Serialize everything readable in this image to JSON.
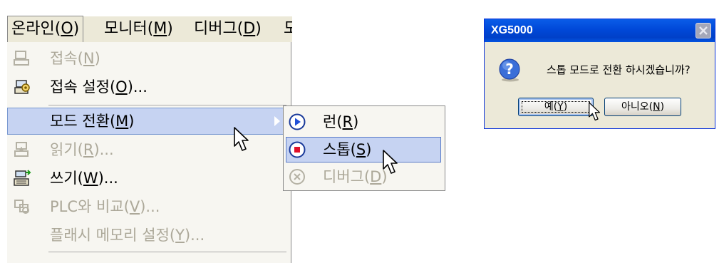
{
  "menubar": {
    "items": [
      {
        "label": "온라인(O)",
        "text": "온라인(",
        "mnemonic": "O",
        "close": ")"
      },
      {
        "label": "모니터(M)",
        "text": "모니터(",
        "mnemonic": "M",
        "close": ")"
      },
      {
        "label": "디버그(D)",
        "text": "디버그(",
        "mnemonic": "D",
        "close": ")"
      },
      {
        "label": "도",
        "text": "도",
        "mnemonic": "",
        "close": ""
      }
    ]
  },
  "dropdown": {
    "items": [
      {
        "text": "접속(",
        "mnemonic": "N",
        "close": ")",
        "icon": "connect-icon",
        "disabled": true
      },
      {
        "text": "접속 설정(",
        "mnemonic": "O",
        "close": ")...",
        "icon": "connection-settings-icon",
        "disabled": false
      },
      {
        "text": "모드 전환(",
        "mnemonic": "M",
        "close": ")",
        "icon": "",
        "disabled": false,
        "highlighted": true,
        "submenu": true
      },
      {
        "text": "읽기(",
        "mnemonic": "R",
        "close": ")...",
        "icon": "read-icon",
        "disabled": true
      },
      {
        "text": "쓰기(",
        "mnemonic": "W",
        "close": ")...",
        "icon": "write-icon",
        "disabled": false
      },
      {
        "text": "PLC와 비교(",
        "mnemonic": "V",
        "close": ")...",
        "icon": "compare-icon",
        "disabled": true
      },
      {
        "text": "플래시 메모리 설정(",
        "mnemonic": "Y",
        "close": ")...",
        "icon": "",
        "disabled": true
      }
    ]
  },
  "submenu": {
    "items": [
      {
        "text": "런(",
        "mnemonic": "R",
        "close": ")",
        "icon": "run-icon",
        "disabled": false
      },
      {
        "text": "스톱(",
        "mnemonic": "S",
        "close": ")",
        "icon": "stop-icon",
        "disabled": false,
        "highlighted": true
      },
      {
        "text": "디버그(",
        "mnemonic": "D",
        "close": ")",
        "icon": "debug-icon",
        "disabled": true
      }
    ]
  },
  "dialog": {
    "title": "XG5000",
    "message": "스톱 모드로 전환 하시겠습니까?",
    "yes": {
      "text": "예(",
      "mnemonic": "Y",
      "close": ")"
    },
    "no": {
      "text": "아니오(",
      "mnemonic": "N",
      "close": ")"
    }
  },
  "colors": {
    "menu_highlight": "#c6d3f2",
    "titlebar": "#0048d8",
    "menubar": "#ece9d8"
  }
}
